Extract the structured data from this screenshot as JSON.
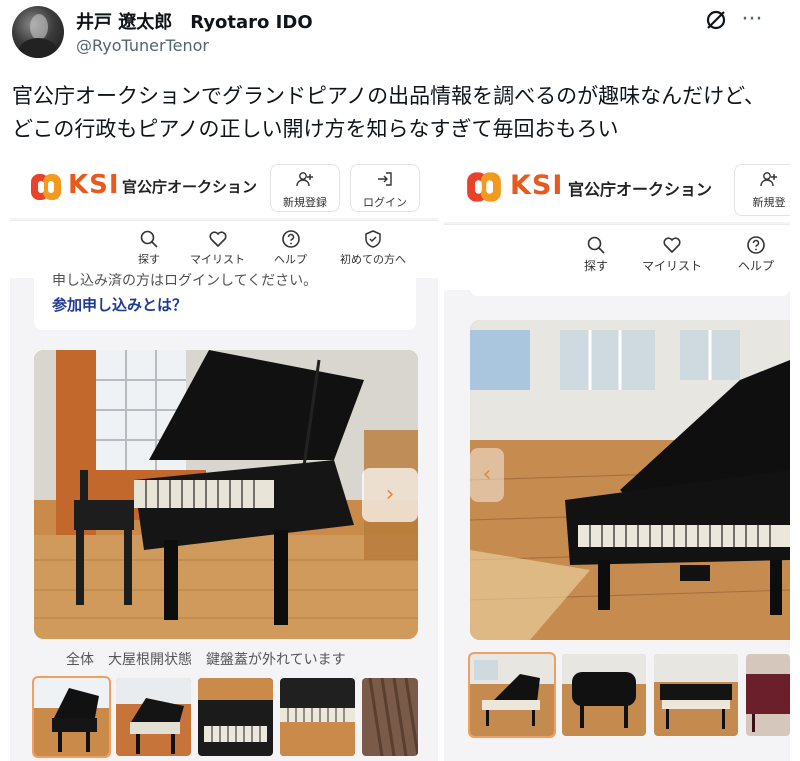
{
  "tweet": {
    "display_name": "井戸 遼太郎　Ryotaro IDO",
    "handle": "@RyoTunerTenor",
    "text": "官公庁オークションでグランドピアノの出品情報を調べるのが趣味なんだけど、どこの行政もピアノの正しい開け方を知らなすぎて毎回おもろい",
    "icons": [
      "grok-icon",
      "more-icon"
    ]
  },
  "screens": [
    {
      "logo_text": "KSI",
      "site_name": "官公庁オークション",
      "header_buttons": [
        {
          "label": "新規登録",
          "icon": "add-user-icon"
        },
        {
          "label": "ログイン",
          "icon": "login-icon"
        }
      ],
      "nav": [
        {
          "label": "探す",
          "icon": "search-icon"
        },
        {
          "label": "マイリスト",
          "icon": "heart-icon"
        },
        {
          "label": "ヘルプ",
          "icon": "help-icon"
        },
        {
          "label": "初めての方へ",
          "icon": "shield-icon"
        }
      ],
      "notice_partial": "申し込み済の方はログインしてください。",
      "notice_link": "参加申し込みとは？",
      "caption": "全体　大屋根開状態　鍵盤蓋が外れています"
    },
    {
      "logo_text": "KSI",
      "site_name": "官公庁オークション",
      "header_buttons": [
        {
          "label": "新規登",
          "icon": "add-user-icon"
        }
      ],
      "nav": [
        {
          "label": "探す",
          "icon": "search-icon"
        },
        {
          "label": "マイリスト",
          "icon": "heart-icon"
        },
        {
          "label": "ヘルプ",
          "icon": "help-icon"
        }
      ]
    }
  ],
  "colors": {
    "brand": "#e75a1c",
    "link": "#1f3a93",
    "panel_bg": "#f4f4f6"
  }
}
